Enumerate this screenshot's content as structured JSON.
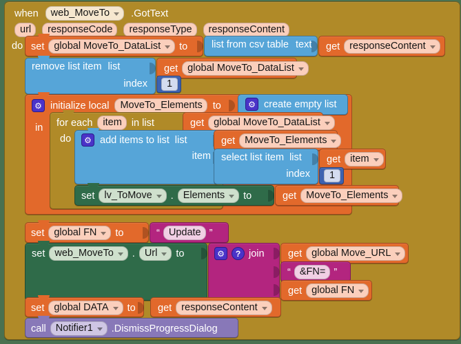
{
  "editor": {
    "background_color": "#4a7150",
    "app": "MIT App Inventor Blocks Editor"
  },
  "event_block": {
    "when_label": "when",
    "component": "web_MoveTo",
    "event": ".GotText",
    "params": [
      "url",
      "responseCode",
      "responseType",
      "responseContent"
    ],
    "do_label": "do",
    "color": "#b08a28"
  },
  "statements": {
    "set_datalist": {
      "set_label": "set",
      "variable": "global MoveTo_DataList",
      "to_label": "to",
      "value_block": {
        "name": "list from csv table",
        "socket_label": "text",
        "value": {
          "get_label": "get",
          "variable": "responseContent"
        }
      }
    },
    "remove_list_item": {
      "name": "remove list item",
      "list_label": "list",
      "list_value": {
        "get_label": "get",
        "variable": "global MoveTo_DataList"
      },
      "index_label": "index",
      "index_value": "1"
    },
    "initialize_local": {
      "name": "initialize local",
      "variable": "MoveTo_Elements",
      "to_label": "to",
      "value_block": {
        "name": "create empty list"
      },
      "in_label": "in"
    },
    "for_each": {
      "for_each_label": "for each",
      "loop_var": "item",
      "in_list_label": "in list",
      "list_value": {
        "get_label": "get",
        "variable": "global MoveTo_DataList"
      },
      "do_label": "do"
    },
    "add_items_to_list": {
      "name": "add items to list",
      "list_label": "list",
      "list_value": {
        "get_label": "get",
        "variable": "MoveTo_Elements"
      },
      "item_label": "item",
      "item_value": {
        "name": "select list item",
        "list_label": "list",
        "list_value": {
          "get_label": "get",
          "variable": "item"
        },
        "index_label": "index",
        "index_value": "1"
      }
    },
    "set_lv_elements": {
      "set_label": "set",
      "component": "lv_ToMove",
      "dot": ".",
      "property": "Elements",
      "to_label": "to",
      "value": {
        "get_label": "get",
        "variable": "MoveTo_Elements"
      }
    },
    "set_global_fn": {
      "set_label": "set",
      "variable": "global FN",
      "to_label": "to",
      "text_value": "Update",
      "quote_open": "“",
      "quote_close": "”"
    },
    "set_url": {
      "set_label": "set",
      "component": "web_MoveTo",
      "dot": ".",
      "property": "Url",
      "to_label": "to",
      "join_block": {
        "name": "join",
        "items": [
          {
            "kind": "get",
            "get_label": "get",
            "variable": "global Move_URL"
          },
          {
            "kind": "text",
            "value": "&FN=",
            "quote_open": "“",
            "quote_close": "”"
          },
          {
            "kind": "get",
            "get_label": "get",
            "variable": "global FN"
          }
        ]
      }
    },
    "set_global_data": {
      "set_label": "set",
      "variable": "global DATA",
      "to_label": "to",
      "value": {
        "get_label": "get",
        "variable": "responseContent"
      }
    },
    "call_notifier": {
      "call_label": "call",
      "component": "Notifier1",
      "method": ".DismissProgressDialog"
    }
  },
  "icons": {
    "mutator_gear": "⚙",
    "help": "?"
  },
  "colors": {
    "event": "#b08a28",
    "control": "#b08a28",
    "variable": "#e2692b",
    "list": "#56a5d8",
    "math": "#3d62b0",
    "text": "#b3257f",
    "component_set": "#2f6b49",
    "component_call": "#8878b8",
    "param": "#f2a183"
  }
}
